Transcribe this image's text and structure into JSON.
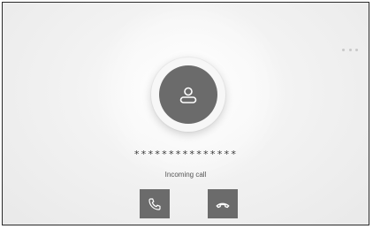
{
  "call": {
    "caller_number": "***************",
    "status": "Incoming call"
  },
  "icons": {
    "avatar": "person-icon",
    "answer": "phone-icon",
    "decline": "hang-up-icon",
    "more": "more-dots-icon"
  },
  "colors": {
    "button": "#6b6b6b",
    "avatar_bg": "#6b6b6b",
    "background": "#efefef"
  }
}
